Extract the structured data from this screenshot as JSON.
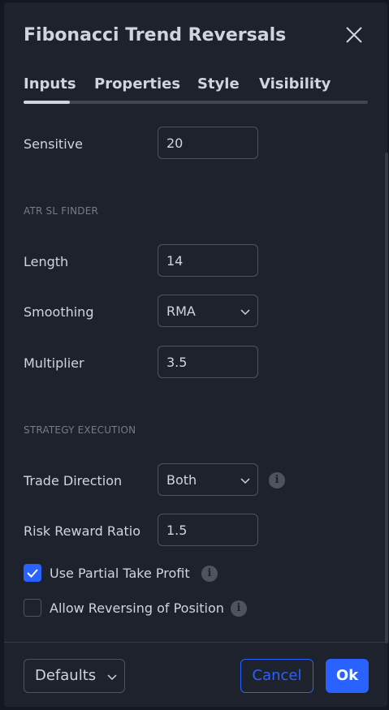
{
  "dialog": {
    "title": "Fibonacci Trend Reversals",
    "tabs": [
      {
        "label": "Inputs",
        "active": true
      },
      {
        "label": "Properties",
        "active": false
      },
      {
        "label": "Style",
        "active": false
      },
      {
        "label": "Visibility",
        "active": false
      }
    ]
  },
  "inputs": {
    "sensitive": {
      "label": "Sensitive",
      "value": "20"
    },
    "atr_section": "ATR SL FINDER",
    "length": {
      "label": "Length",
      "value": "14"
    },
    "smoothing": {
      "label": "Smoothing",
      "value": "RMA"
    },
    "multiplier": {
      "label": "Multiplier",
      "value": "3.5"
    },
    "strategy_section": "STRATEGY EXECUTION",
    "trade_direction": {
      "label": "Trade Direction",
      "value": "Both"
    },
    "risk_reward": {
      "label": "Risk Reward Ratio",
      "value": "1.5"
    },
    "partial_tp": {
      "label": "Use Partial Take Profit",
      "checked": true
    },
    "allow_reverse": {
      "label": "Allow Reversing of Position",
      "checked": false
    }
  },
  "footer": {
    "defaults_label": "Defaults",
    "cancel_label": "Cancel",
    "ok_label": "Ok"
  },
  "colors": {
    "accent": "#2962ff",
    "background": "#1e222d",
    "text": "#d1d4dc",
    "muted": "#787b86"
  },
  "icons": {
    "close": "close-icon",
    "chevron": "chevron-down-icon",
    "info": "info-icon",
    "check": "check-icon"
  }
}
